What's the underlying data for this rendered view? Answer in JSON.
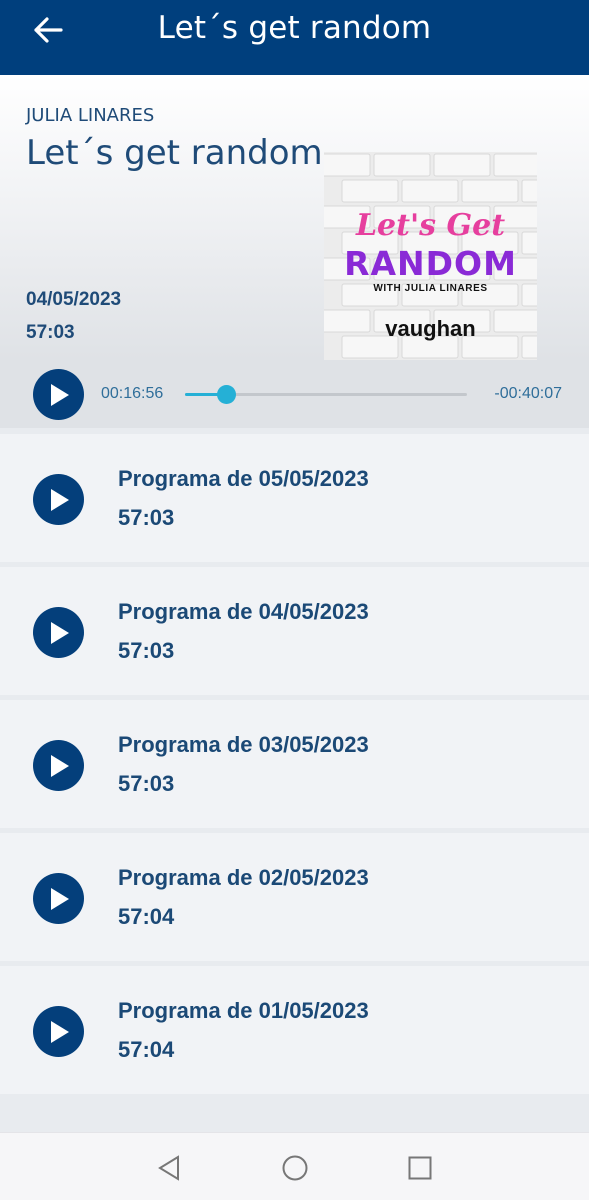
{
  "header": {
    "title": "Let´s get random",
    "back_icon": "arrow-left-icon"
  },
  "show": {
    "author": "JULIA LINARES",
    "title": "Let´s get random",
    "date": "04/05/2023",
    "duration": "57:03",
    "cover": {
      "line1": "Let's Get",
      "line2": "RANDOM",
      "line3": "WITH JULIA LINARES",
      "line4": "vaughan"
    }
  },
  "player": {
    "elapsed": "00:16:56",
    "remaining": "-00:40:07",
    "progress": 0.15,
    "accent_color": "#25b0d6"
  },
  "episodes": [
    {
      "title": "Programa de 05/05/2023",
      "duration": "57:03"
    },
    {
      "title": "Programa de 04/05/2023",
      "duration": "57:03"
    },
    {
      "title": "Programa de 03/05/2023",
      "duration": "57:03"
    },
    {
      "title": "Programa de 02/05/2023",
      "duration": "57:04"
    },
    {
      "title": "Programa de 01/05/2023",
      "duration": "57:04"
    }
  ],
  "colors": {
    "primary": "#003f7d",
    "text": "#1b4976"
  },
  "nav": {
    "back_icon": "triangle-back-icon",
    "home_icon": "circle-home-icon",
    "recents_icon": "square-recents-icon"
  }
}
